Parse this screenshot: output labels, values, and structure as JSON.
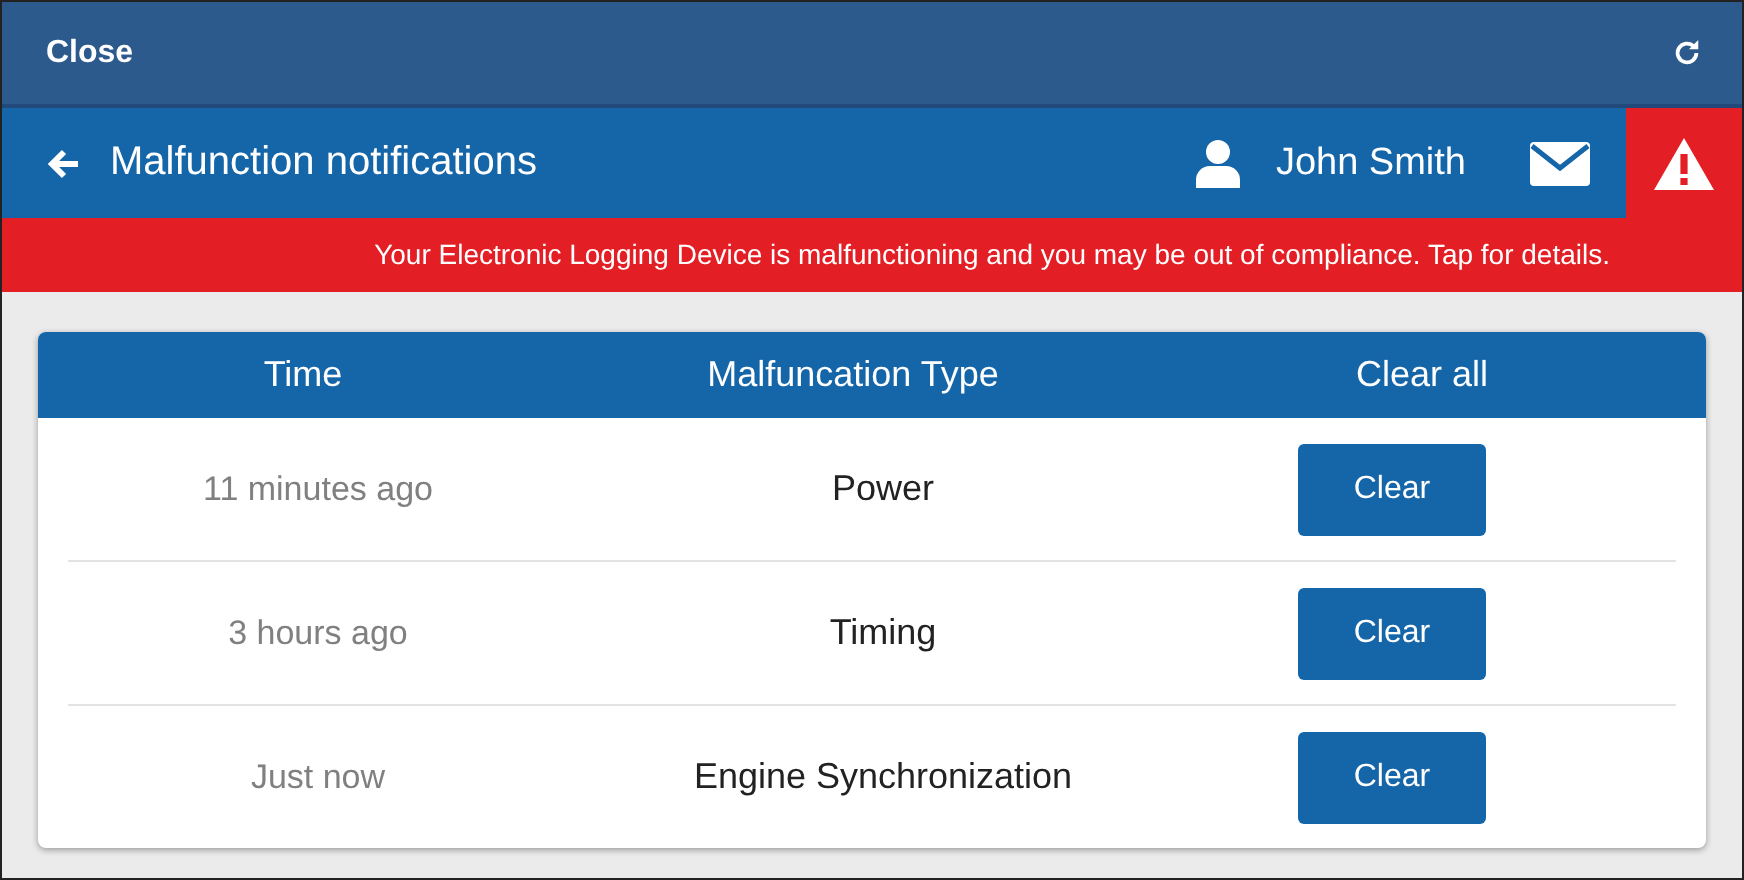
{
  "top_bar": {
    "close": "Close"
  },
  "header": {
    "title": "Malfunction notifications",
    "user": "John Smith"
  },
  "alert_banner": "Your Electronic Logging Device is malfunctioning and you may be out of compliance. Tap for details.",
  "table": {
    "columns": [
      "Time",
      "Malfuncation Type",
      "Clear all"
    ],
    "rows": [
      {
        "time": "11 minutes ago",
        "type": "Power",
        "action": "Clear"
      },
      {
        "time": "3 hours ago",
        "type": "Timing",
        "action": "Clear"
      },
      {
        "time": "Just now",
        "type": "Engine Synchronization",
        "action": "Clear"
      }
    ]
  }
}
